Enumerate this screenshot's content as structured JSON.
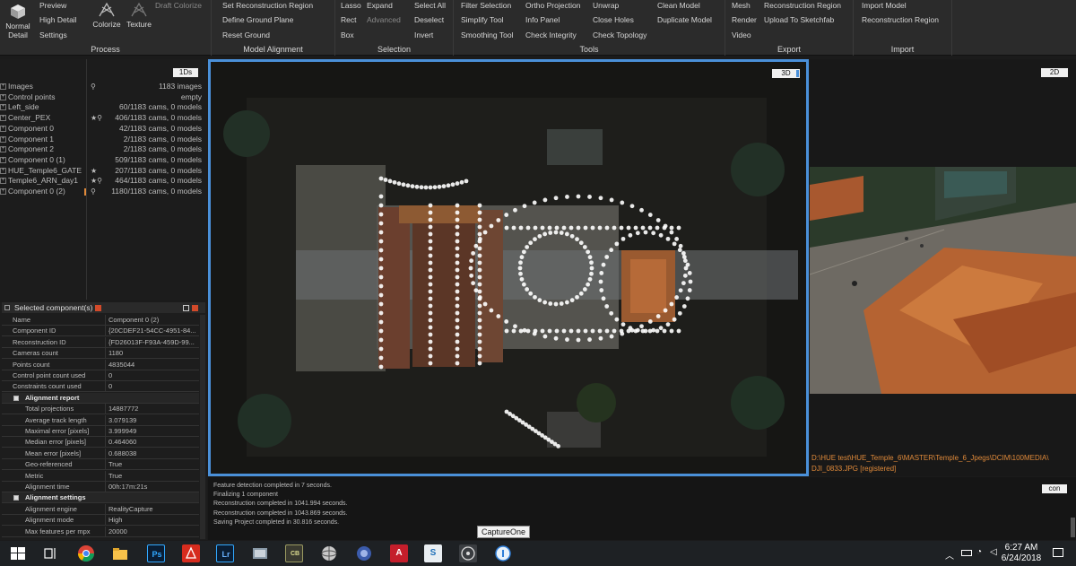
{
  "ribbon": {
    "process": {
      "title": "Process",
      "normal_detail": "Normal Detail",
      "preview": "Preview",
      "high_detail": "High Detail",
      "settings": "Settings",
      "draft_colorize": "Draft Colorize",
      "colorize": "Colorize",
      "texture": "Texture"
    },
    "model_alignment": {
      "title": "Model Alignment",
      "set_region": "Set Reconstruction Region",
      "define_ground": "Define Ground Plane",
      "reset_ground": "Reset Ground"
    },
    "selection": {
      "title": "Selection",
      "lasso": "Lasso",
      "expand": "Expand",
      "select_all": "Select All",
      "rect": "Rect",
      "advanced": "Advanced",
      "deselect": "Deselect",
      "box": "Box",
      "invert": "Invert"
    },
    "tools": {
      "title": "Tools",
      "filter_selection": "Filter Selection",
      "ortho_projection": "Ortho Projection",
      "unwrap": "Unwrap",
      "clean_model": "Clean Model",
      "simplify_tool": "Simplify Tool",
      "info_panel": "Info Panel",
      "close_holes": "Close Holes",
      "duplicate_model": "Duplicate Model",
      "smoothing_tool": "Smoothing Tool",
      "check_integrity": "Check Integrity",
      "check_topology": "Check Topology"
    },
    "export": {
      "title": "Export",
      "mesh": "Mesh",
      "reconstruction_region": "Reconstruction Region",
      "render": "Render",
      "upload_sketchfab": "Upload To Sketchfab",
      "video": "Video"
    },
    "import": {
      "title": "Import",
      "import_model": "Import Model",
      "reconstruction_region": "Reconstruction Region"
    }
  },
  "left": {
    "tab": "1Ds",
    "tree": [
      {
        "name": "Images",
        "icon": "⚲",
        "value": "1183 images"
      },
      {
        "name": "Control points",
        "icon": "",
        "value": "empty"
      },
      {
        "name": "Left_side",
        "icon": "",
        "value": "60/1183 cams, 0 models"
      },
      {
        "name": "Center_PEX",
        "icon": "★⚲",
        "value": "406/1183 cams, 0 models"
      },
      {
        "name": "Component 0",
        "icon": "",
        "value": "42/1183 cams, 0 models"
      },
      {
        "name": "Component 1",
        "icon": "",
        "value": "2/1183 cams, 0 models"
      },
      {
        "name": "Component 2",
        "icon": "",
        "value": "2/1183 cams, 0 models"
      },
      {
        "name": "Component 0 (1)",
        "icon": "",
        "value": "509/1183 cams, 0 models"
      },
      {
        "name": "HUE_Temple6_GATE",
        "icon": "★",
        "value": "207/1183 cams, 0 models"
      },
      {
        "name": "Temple6_ARN_day1",
        "icon": "★⚲",
        "value": "464/1183 cams, 0 models"
      },
      {
        "name": "Component 0 (2)",
        "icon": "⚲",
        "value": "1180/1183 cams, 0 models"
      }
    ]
  },
  "component": {
    "title": "Selected component(s)",
    "rows": [
      {
        "k": "Name",
        "v": "Component 0 (2)",
        "type": "plain"
      },
      {
        "k": "Component ID",
        "v": "{20CDEF21-54CC-4951-84...",
        "type": "plain"
      },
      {
        "k": "Reconstruction ID",
        "v": "{FD26013F-F93A-459D-99...",
        "type": "plain"
      },
      {
        "k": "Cameras count",
        "v": "1180",
        "type": "plain"
      },
      {
        "k": "Points count",
        "v": "4835044",
        "type": "plain"
      },
      {
        "k": "Control point count used",
        "v": "0",
        "type": "plain"
      },
      {
        "k": "Constraints count used",
        "v": "0",
        "type": "plain"
      },
      {
        "k": "Alignment report",
        "v": "",
        "type": "sec"
      },
      {
        "k": "Total projections",
        "v": "14887772",
        "type": "sub"
      },
      {
        "k": "Average track length",
        "v": "3.079139",
        "type": "sub"
      },
      {
        "k": "Maximal error [pixels]",
        "v": "3.999949",
        "type": "sub"
      },
      {
        "k": "Median error [pixels]",
        "v": "0.464060",
        "type": "sub"
      },
      {
        "k": "Mean error [pixels]",
        "v": "0.688038",
        "type": "sub"
      },
      {
        "k": "Geo-referenced",
        "v": "True",
        "type": "sub"
      },
      {
        "k": "Metric",
        "v": "True",
        "type": "sub"
      },
      {
        "k": "Alignment time",
        "v": "00h:17m:21s",
        "type": "sub"
      },
      {
        "k": "Alignment settings",
        "v": "",
        "type": "sec"
      },
      {
        "k": "Alignment engine",
        "v": "RealityCapture",
        "type": "sub"
      },
      {
        "k": "Alignment mode",
        "v": "High",
        "type": "sub"
      },
      {
        "k": "Max features per mpx",
        "v": "20000",
        "type": "sub"
      }
    ]
  },
  "view3d": {
    "tab": "3D"
  },
  "view2d": {
    "tab": "2D",
    "path": "D:\\HUE test\\HUE_Temple_6\\MASTER\\Temple_6_Jpegs\\DCIM\\100MEDIA\\",
    "file": "DJI_0833.JPG [registered]"
  },
  "console": {
    "tab": "con",
    "lines": [
      "Feature detection completed in 7 seconds.",
      "Finalizing 1 component",
      "Reconstruction completed in 1041.994 seconds.",
      "Reconstruction completed in 1043.869 seconds.",
      "Saving Project completed in 30.816 seconds."
    ]
  },
  "taskbar": {
    "tooltip": "CaptureOne",
    "time": "6:27 AM",
    "date": "6/24/2018"
  }
}
